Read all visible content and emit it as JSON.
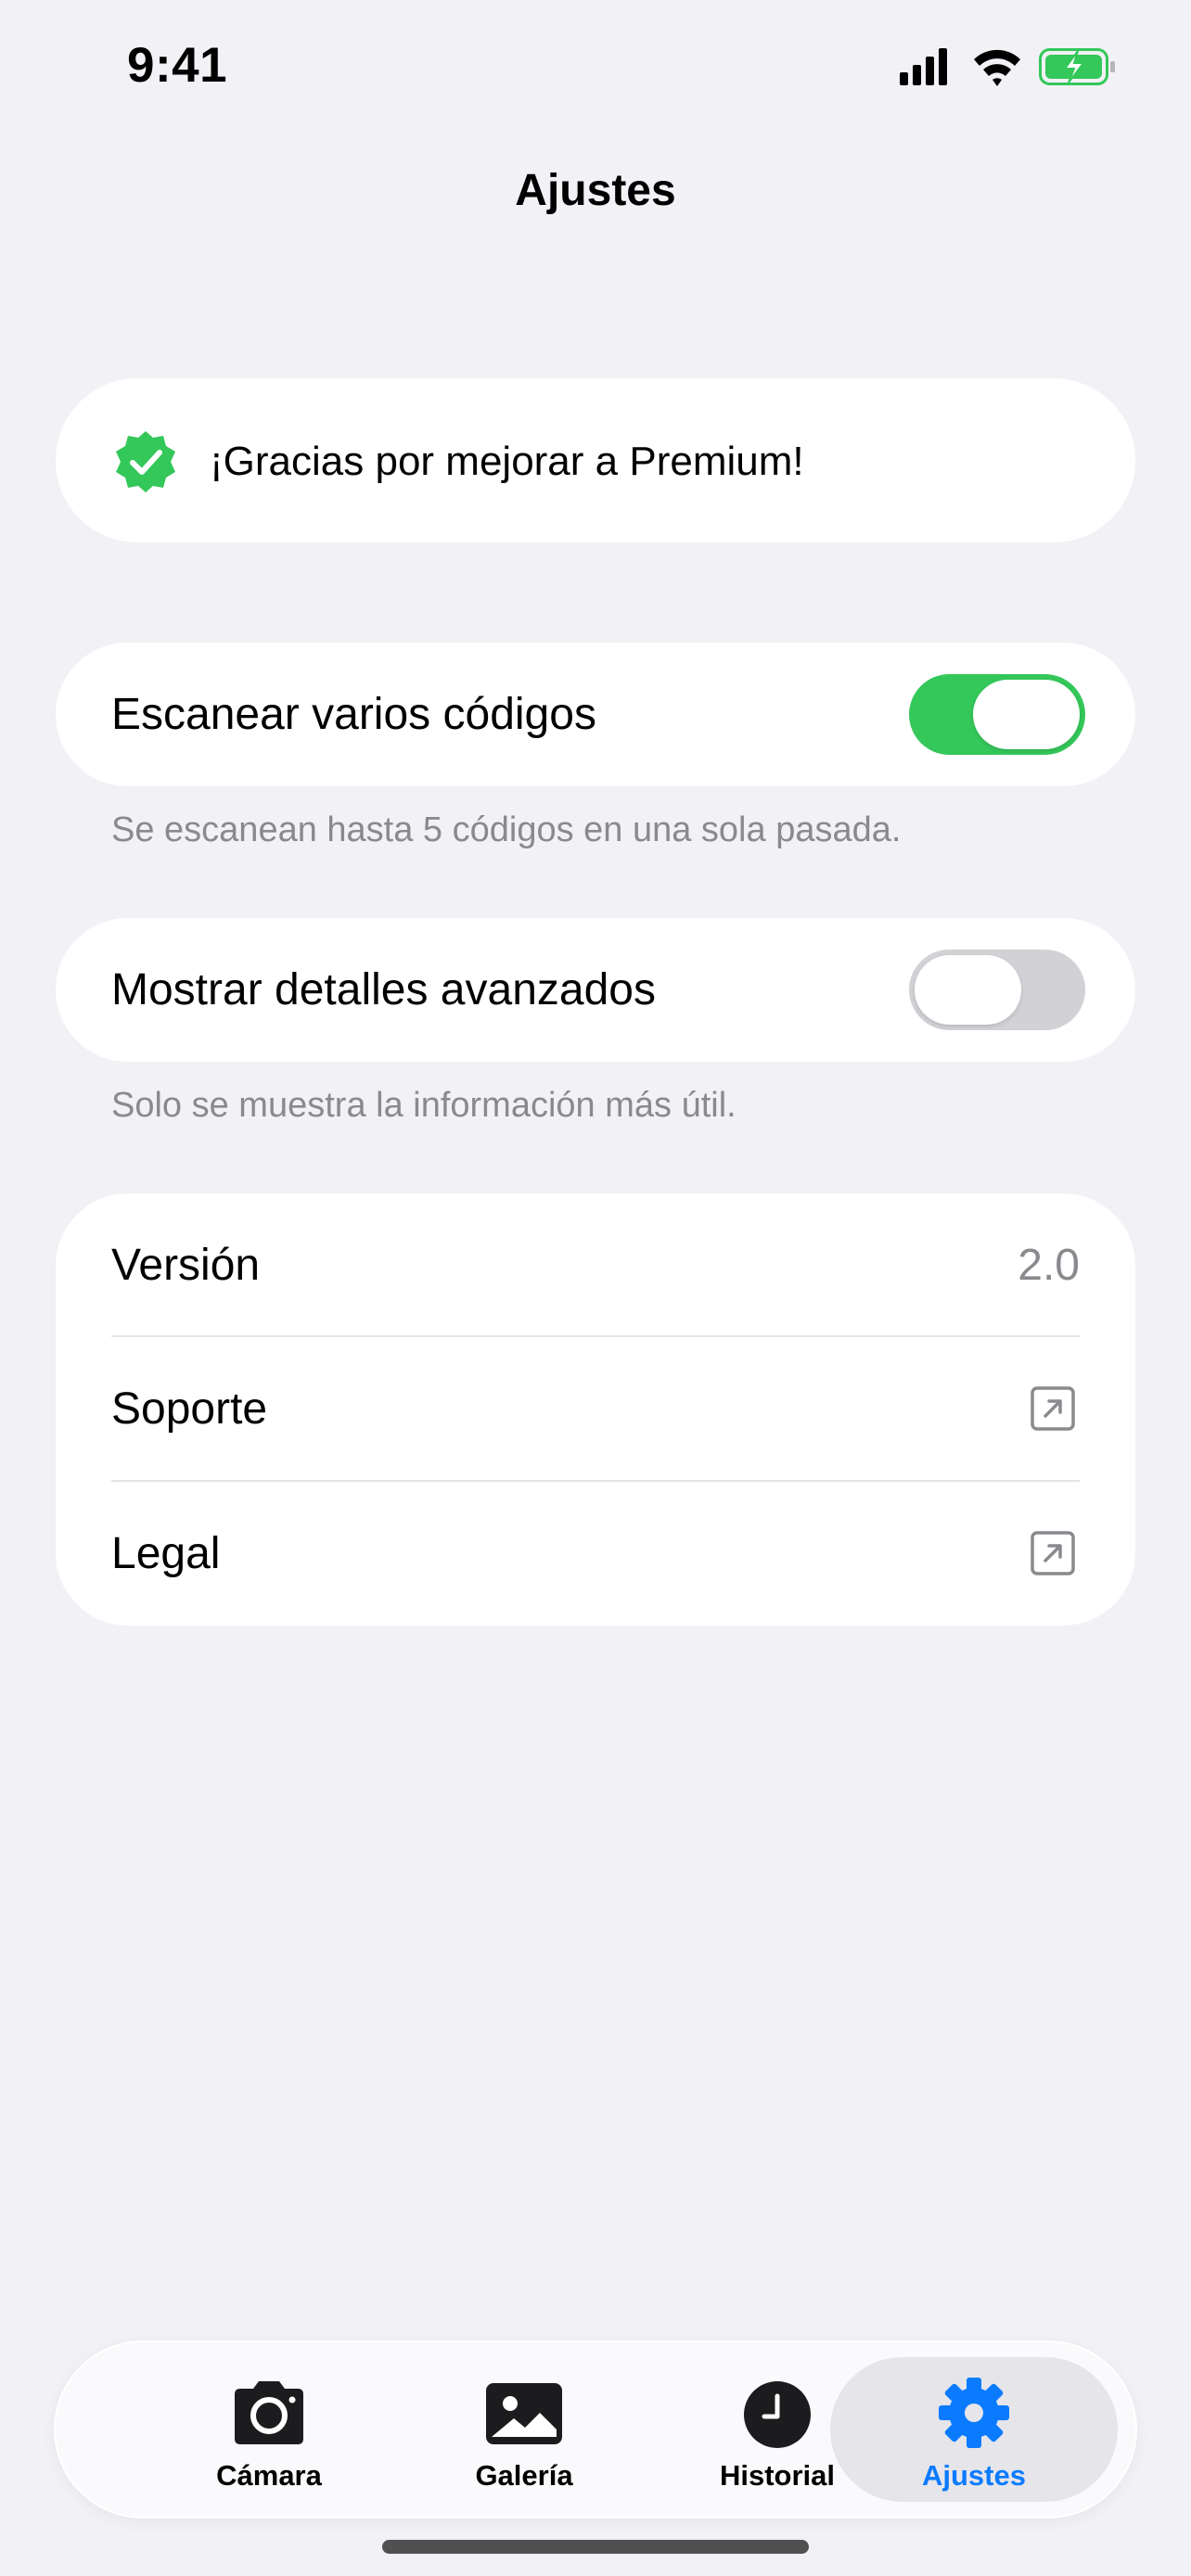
{
  "status_bar": {
    "time": "9:41",
    "icons": [
      "signal-icon",
      "wifi-icon",
      "battery-charging-icon"
    ]
  },
  "nav": {
    "title": "Ajustes"
  },
  "premium": {
    "icon": "verified-badge-icon",
    "message": "¡Gracias por mejorar a Premium!"
  },
  "settings": {
    "multi_scan": {
      "label": "Escanear varios códigos",
      "enabled": true,
      "footer": "Se escanean hasta 5 códigos en una sola pasada."
    },
    "advanced_details": {
      "label": "Mostrar detalles avanzados",
      "enabled": false,
      "footer": "Solo se muestra la información más útil."
    }
  },
  "info": {
    "version_label": "Versión",
    "version_value": "2.0",
    "support_label": "Soporte",
    "legal_label": "Legal"
  },
  "tabs": [
    {
      "label": "Cámara",
      "icon": "camera-icon",
      "selected": false
    },
    {
      "label": "Galería",
      "icon": "gallery-icon",
      "selected": false
    },
    {
      "label": "Historial",
      "icon": "history-clock-icon",
      "selected": false
    },
    {
      "label": "Ajustes",
      "icon": "gear-icon",
      "selected": true
    }
  ],
  "colors": {
    "background": "#f2f1f6",
    "accent": "#0a7bff",
    "switch_on": "#34c759",
    "switch_off": "#d1d1d6",
    "secondary_text": "#8a8a8e"
  }
}
